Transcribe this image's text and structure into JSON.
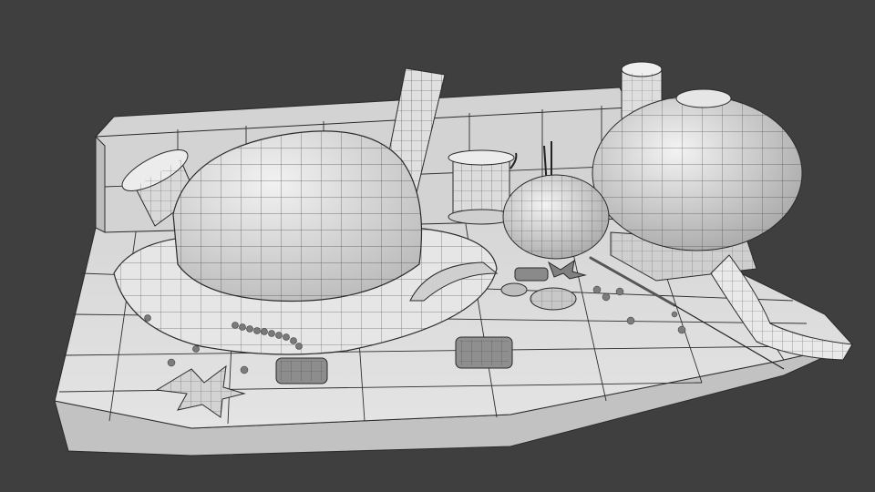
{
  "viewport": {
    "background": "#3f3f3f",
    "render_style": "grayscale wireframe clay render"
  },
  "scene": {
    "objects": [
      "display-base",
      "back-wall",
      "bowler-hat",
      "ruler",
      "thread-spool-left",
      "thread-spool-center",
      "pincushion",
      "sewing-needle",
      "large-round-pincushion",
      "thimble",
      "tape-measure",
      "star-pillow",
      "square-buttons",
      "round-buttons",
      "bead-scatter"
    ]
  },
  "colors": {
    "base_top": "#dcdcdc",
    "base_side": "#bdbdbd",
    "wire": "#2a2a2a",
    "hat": "#e4e4e4",
    "shadow": "#9a9a9a"
  }
}
